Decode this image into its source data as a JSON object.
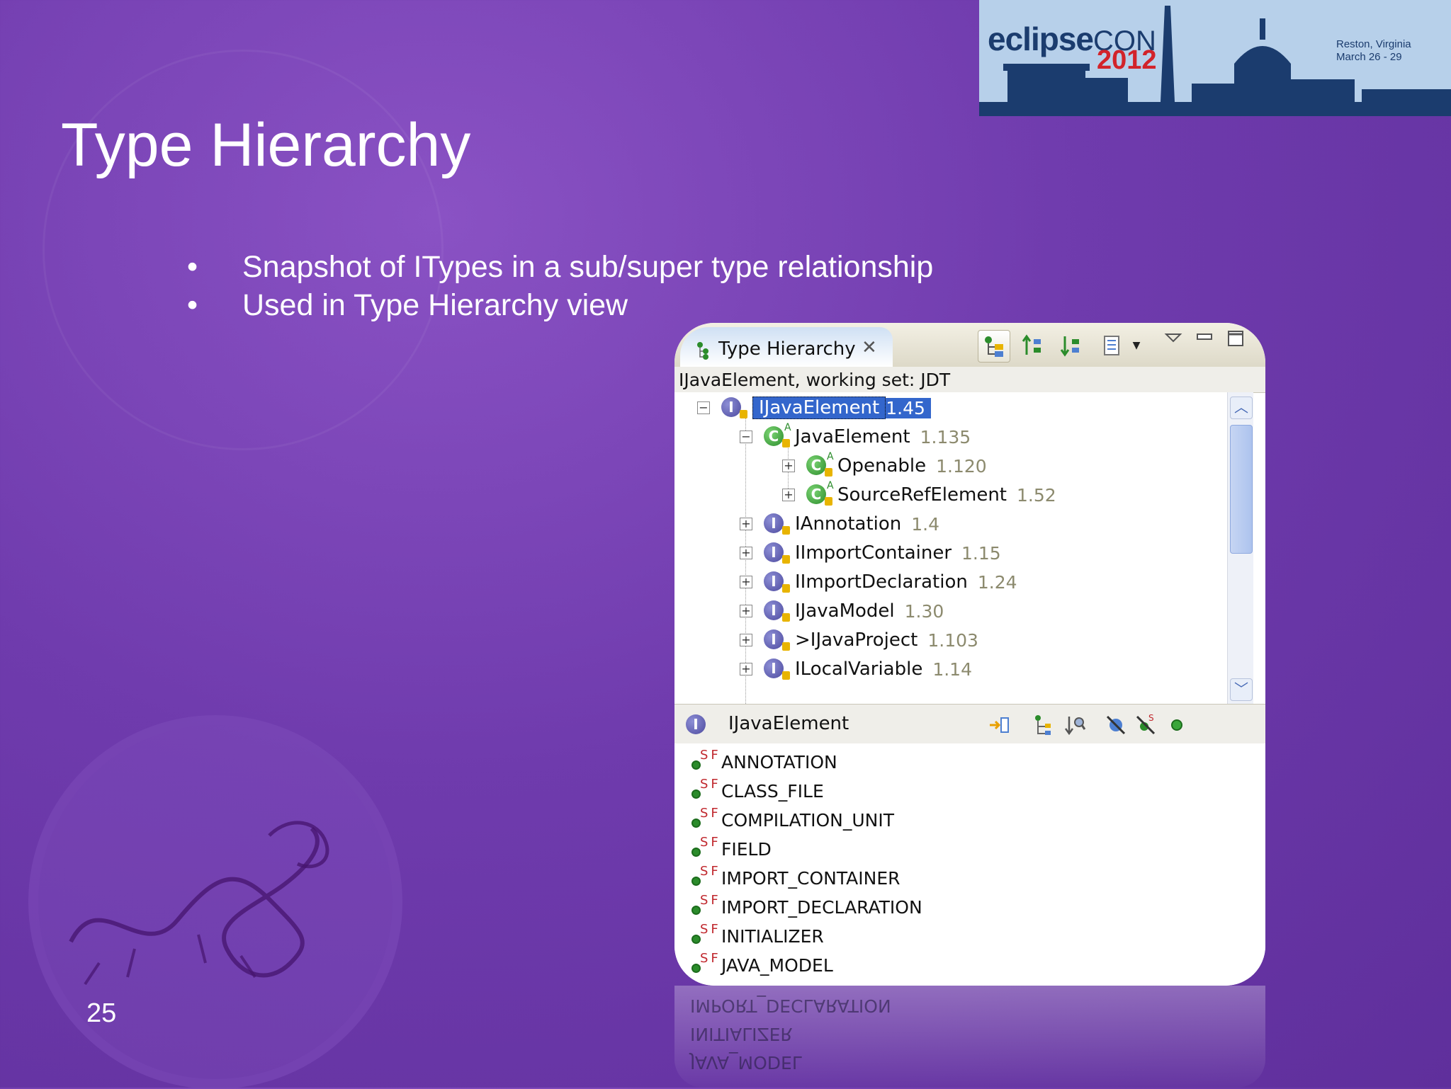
{
  "slide": {
    "title": "Type Hierarchy",
    "bullets": [
      "Snapshot of ITypes in a sub/super type relationship",
      "Used in Type Hierarchy view"
    ],
    "page_number": "25"
  },
  "banner": {
    "brand": "eclipse",
    "brand_suffix": "CON",
    "year": "2012",
    "location": "Reston, Virginia",
    "dates": "March 26 - 29",
    "colors": {
      "navy": "#1b3c6e",
      "red": "#d2232a",
      "sky": "#b7d0ea"
    }
  },
  "view": {
    "tab_label": "Type Hierarchy",
    "close_icon": "close-icon",
    "toolbar": [
      "show-type-hierarchy-icon",
      "show-supertype-hierarchy-icon",
      "show-subtype-hierarchy-icon",
      "history-icon",
      "view-menu-icon"
    ],
    "header": "IJavaElement, working set: JDT",
    "tree": [
      {
        "name": "IJavaElement",
        "version": "1.45",
        "kind": "interface",
        "level": 0,
        "expander": "minus",
        "selected": true
      },
      {
        "name": "JavaElement",
        "version": "1.135",
        "kind": "class-abstract",
        "level": 1,
        "expander": "minus"
      },
      {
        "name": "Openable",
        "version": "1.120",
        "kind": "class-abstract",
        "level": 2,
        "expander": "plus"
      },
      {
        "name": "SourceRefElement",
        "version": "1.52",
        "kind": "class-abstract",
        "level": 2,
        "expander": "plus"
      },
      {
        "name": "IAnnotation",
        "version": "1.4",
        "kind": "interface",
        "level": 1,
        "expander": "plus"
      },
      {
        "name": "IImportContainer",
        "version": "1.15",
        "kind": "interface",
        "level": 1,
        "expander": "plus"
      },
      {
        "name": "IImportDeclaration",
        "version": "1.24",
        "kind": "interface",
        "level": 1,
        "expander": "plus"
      },
      {
        "name": "IJavaModel",
        "version": "1.30",
        "kind": "interface",
        "level": 1,
        "expander": "plus"
      },
      {
        "name": ">IJavaProject",
        "version": "1.103",
        "kind": "interface",
        "level": 1,
        "expander": "plus"
      },
      {
        "name": "ILocalVariable",
        "version": "1.14",
        "kind": "interface",
        "level": 1,
        "expander": "plus"
      }
    ],
    "members_header": "IJavaElement",
    "members": [
      "ANNOTATION",
      "CLASS_FILE",
      "COMPILATION_UNIT",
      "FIELD",
      "IMPORT_CONTAINER",
      "IMPORT_DECLARATION",
      "INITIALIZER",
      "JAVA_MODEL"
    ],
    "colors": {
      "selection": "#3366cc",
      "interface": "#4d4a9e",
      "class": "#2b8c2b",
      "version": "#8c8a6e"
    }
  }
}
